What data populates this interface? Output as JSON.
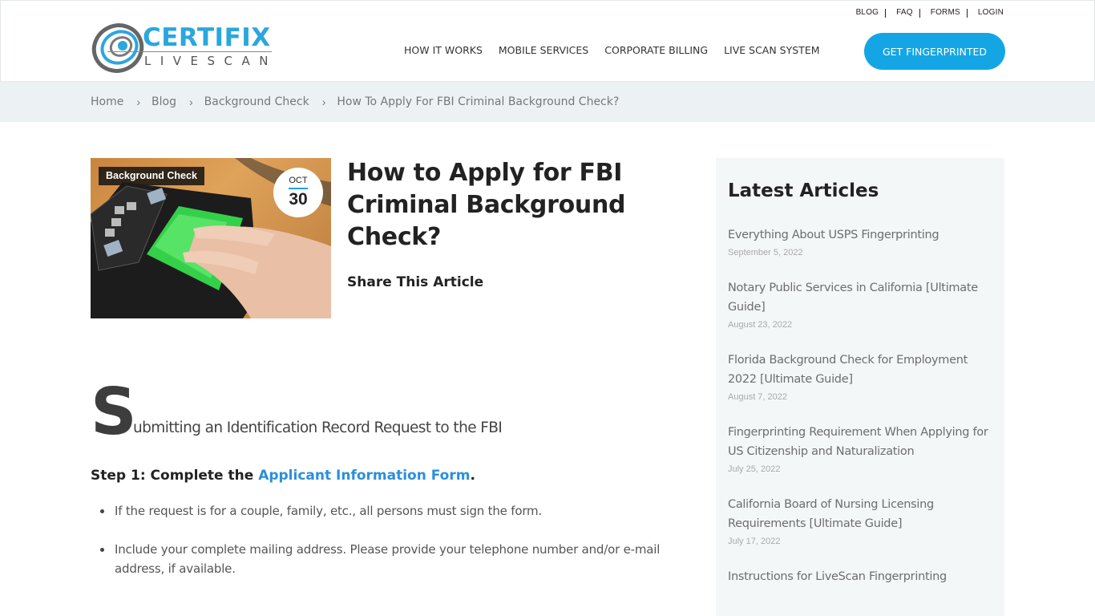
{
  "header": {
    "logo": {
      "primary": "CERTIFIX",
      "secondary": "LIVESCAN"
    },
    "utility_nav": [
      "BLOG",
      "FAQ",
      "FORMS",
      "LOGIN"
    ],
    "main_nav": [
      "HOW IT WORKS",
      "MOBILE SERVICES",
      "CORPORATE BILLING",
      "LIVE SCAN SYSTEM"
    ],
    "cta_label": "GET FINGERPRINTED"
  },
  "breadcrumb": {
    "items": [
      "Home",
      "Blog",
      "Background Check"
    ],
    "current": "How To Apply For FBI Criminal Background Check?",
    "separator": "›"
  },
  "post": {
    "category": "Background Check",
    "date": {
      "month": "OCT",
      "day": "30"
    },
    "title": "How to Apply for FBI Criminal Background Check?",
    "share_label": "Share This Article",
    "dropcap_letter": "S",
    "heading_rest": "ubmitting an Identification Record Request to the FBI",
    "step1": {
      "prefix": "Step 1: Complete the ",
      "link_text": "Applicant Information Form",
      "suffix": "."
    },
    "bullets": [
      "If the request is for a couple, family, etc., all persons must sign the form.",
      "Include your complete mailing address. Please provide your telephone number and/or e-mail address, if available."
    ]
  },
  "sidebar": {
    "title": "Latest Articles",
    "articles": [
      {
        "title": "Everything About USPS Fingerprinting",
        "date": "September 5, 2022"
      },
      {
        "title": "Notary Public Services in California [Ultimate Guide]",
        "date": "August 23, 2022"
      },
      {
        "title": "Florida Background Check for Employment 2022 [Ultimate Guide]",
        "date": "August 7, 2022"
      },
      {
        "title": "Fingerprinting Requirement When Applying for US Citizenship and Naturalization",
        "date": "July 25, 2022"
      },
      {
        "title": "California Board of Nursing Licensing Requirements [Ultimate Guide]",
        "date": "July 17, 2022"
      },
      {
        "title": "Instructions for LiveScan Fingerprinting",
        "date": ""
      }
    ]
  },
  "colors": {
    "brand_blue": "#2ba6de",
    "cta_blue": "#14a6e4",
    "link_blue": "#2b8fdb",
    "breadcrumb_bg": "#ecf2f4",
    "sidebar_bg": "#f4f7f8"
  }
}
